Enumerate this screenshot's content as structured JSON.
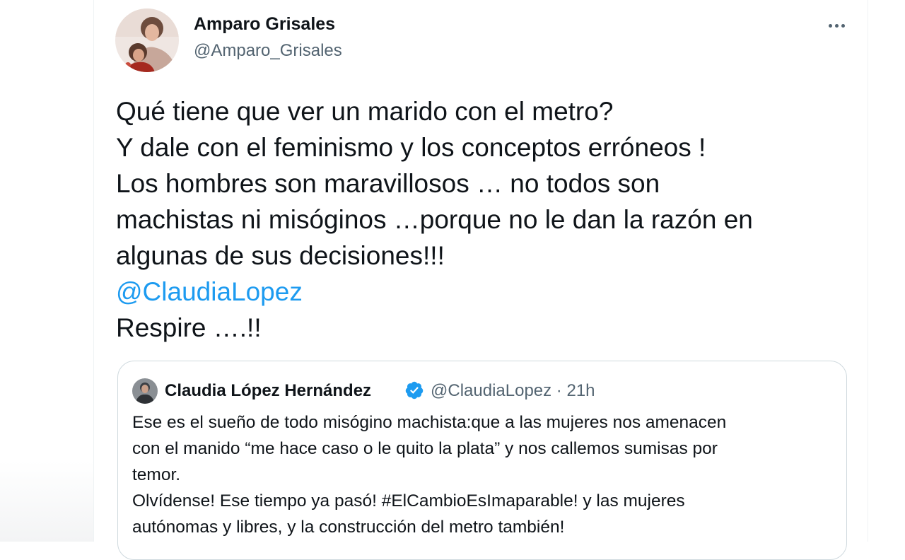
{
  "tweet": {
    "author_name": "Amparo Grisales",
    "author_handle": "@Amparo_Grisales",
    "more_icon": "more-horizontal-icon",
    "text_lines": [
      "Qué tiene que ver un marido con el metro?",
      "Y dale con el feminismo y los conceptos erróneos !",
      "Los hombres son maravillosos … no todos son",
      "machistas ni misóginos …porque no le dan la razón en",
      "algunas de sus decisiones!!!"
    ],
    "mention": "@ClaudiaLopez",
    "closing_line": "Respire ….!!"
  },
  "quote": {
    "author_name": "Claudia López Hernández",
    "verified_icon": "verified-badge-icon",
    "handle_time": "@ClaudiaLopez · 21h",
    "text_lines": [
      "Ese es el sueño de todo misógino machista:que a las mujeres nos amenacen",
      "con el manido “me hace caso o le quito la plata” y nos callemos sumisas por",
      "temor.",
      "Olvídense! Ese tiempo ya pasó! #ElCambioEsImaparable! y las mujeres",
      "autónomas y libres, y la construcción del metro también!"
    ]
  },
  "colors": {
    "link": "#1d9bf0",
    "text": "#0f1419",
    "secondary": "#536471",
    "border": "#cfd9de"
  }
}
